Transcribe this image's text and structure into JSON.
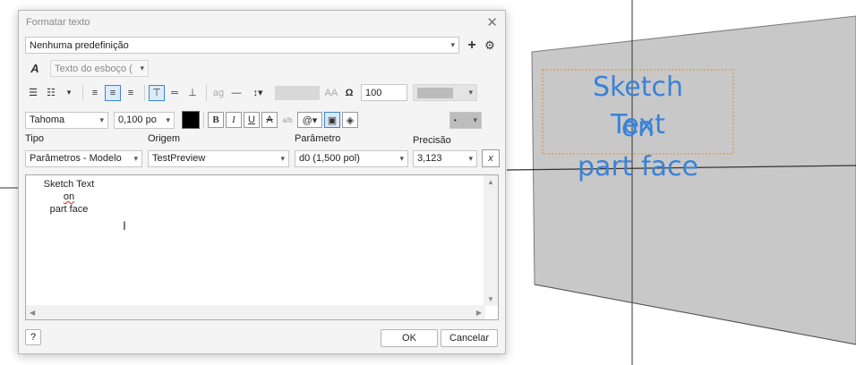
{
  "dialog": {
    "title": "Formatar texto",
    "preset": "Nenhuma predefinição",
    "style_select": "Texto do esboço (",
    "spacing_value": "100",
    "font": "Tahoma",
    "font_size": "0,100 po",
    "labels": {
      "tipo": "Tipo",
      "origem": "Origem",
      "parametro": "Parâmetro",
      "precisao": "Precisão"
    },
    "tipo_value": "Parâmetros - Modelo",
    "origem_value": "TestPreview",
    "parametro_value": "d0 (1,500 pol)",
    "precisao_value": "3,123",
    "editor_lines": [
      "Sketch Text",
      "on",
      "part face"
    ],
    "ok_label": "OK",
    "cancel_label": "Cancelar"
  },
  "viewport": {
    "sketch_lines": [
      "Sketch Text",
      "on",
      "part face"
    ]
  },
  "colors": {
    "accent": "#3c84d8",
    "sketch_text": "#3b82d6",
    "face": "#c8c8c8"
  }
}
